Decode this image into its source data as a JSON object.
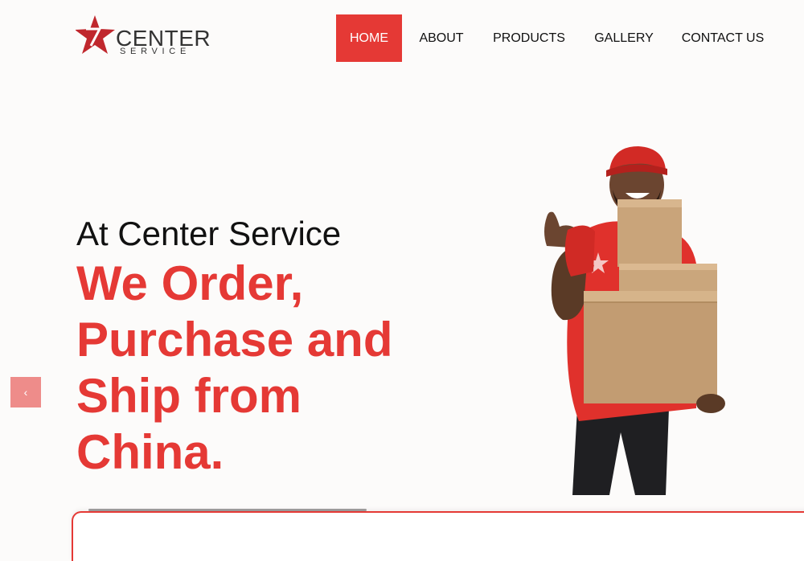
{
  "brand": {
    "name_line1": "CENTER",
    "name_line2": "SERVICE"
  },
  "nav": {
    "items": [
      {
        "label": "HOME",
        "active": true
      },
      {
        "label": "ABOUT",
        "active": false
      },
      {
        "label": "PRODUCTS",
        "active": false
      },
      {
        "label": "GALLERY",
        "active": false
      },
      {
        "label": "CONTACT US",
        "active": false
      }
    ]
  },
  "hero": {
    "intro": "At Center Service",
    "title_lines": [
      "We Order,",
      "Purchase and",
      "Ship from",
      "China."
    ],
    "prev_arrow": "‹",
    "image_subject": "delivery man in red cap and t-shirt carrying cardboard boxes, giving a thumbs up"
  },
  "colors": {
    "accent": "#e53935",
    "background": "#fcfbfa",
    "text": "#111111",
    "arrow_bg": "#ee8c8a"
  },
  "icons": {
    "logo": "red-star-logo-icon",
    "prev": "chevron-left-icon"
  }
}
